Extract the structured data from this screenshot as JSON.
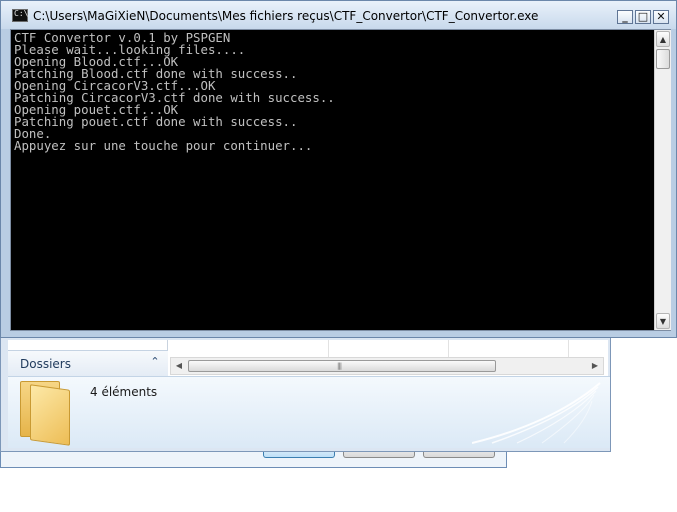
{
  "console_window": {
    "title": "C:\\Users\\MaGiXieN\\Documents\\Mes fichiers reçus\\CTF_Convertor\\CTF_Convertor.exe",
    "app_icon": "cmd-icon",
    "app_icon_text": "C:\\",
    "controls": {
      "minimize": "_",
      "maximize": "□",
      "close": "✕"
    },
    "output_lines": [
      "CTF Convertor v.0.1 by PSPGEN",
      "Please wait...looking files....",
      "Opening Blood.ctf...OK",
      "Patching Blood.ctf done with success..",
      "Opening CircacorV3.ctf...OK",
      "Patching CircacorV3.ctf done with success..",
      "Opening pouet.ctf...OK",
      "Patching pouet.ctf done with success..",
      "Done.",
      "Appuyez sur une touche pour continuer..."
    ],
    "colors": {
      "background": "#000000",
      "text": "#c0c0c0"
    },
    "scrollbar": {
      "up_glyph": "▲",
      "down_glyph": "▼"
    }
  },
  "explorer_window": {
    "folders_label": "Dossiers",
    "folders_toggle_glyph": "⌃",
    "hscroll": {
      "left_glyph": "◀",
      "right_glyph": "▶",
      "grip_glyph": "|||"
    },
    "details": {
      "icon": "folder-icon",
      "item_count": "4 éléments"
    }
  }
}
